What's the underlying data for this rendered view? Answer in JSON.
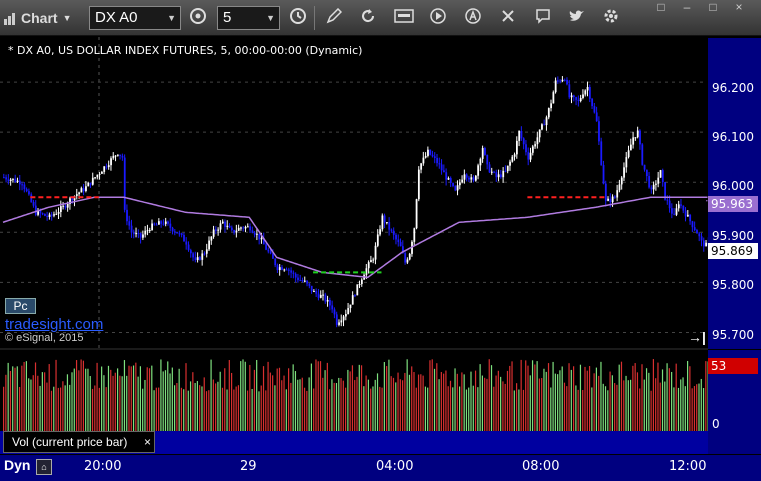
{
  "toolbar": {
    "chart_label": "Chart",
    "symbol": "DX A0",
    "interval": "5",
    "buttons": [
      "link-icon",
      "interval-icon",
      "draw-icon",
      "refresh-icon",
      "get-icon",
      "play-icon",
      "alert-icon",
      "tools-icon",
      "comment-icon",
      "twitter-icon",
      "settings-icon"
    ]
  },
  "window_controls": [
    "□",
    "–",
    "□",
    "×"
  ],
  "chart": {
    "title": "* DX A0, US DOLLAR INDEX FUTURES, 5, 00:00-00:00 (Dynamic)",
    "y_ticks": [
      "96.200",
      "96.100",
      "96.000",
      "95.900",
      "95.800",
      "95.700"
    ],
    "price_labels": {
      "vwap": "95.963",
      "last": "95.869"
    },
    "pc_label": "Pc",
    "brand": "tradesight.com",
    "copyright": "© eSignal, 2015",
    "colors": {
      "up_bar": "#ffffff",
      "down_bar": "#1a1aff",
      "vwap": "#b07be0",
      "support": "#ff2020",
      "resistance": "#20d020",
      "count": "#00a000"
    }
  },
  "volume": {
    "label": "Vol (current price bar)",
    "close_label": "×",
    "y_ticks": [
      "53",
      "0"
    ]
  },
  "x_axis": {
    "mode_label": "Dyn",
    "ticks": [
      "20:00",
      "29",
      "04:00",
      "08:00",
      "12:00"
    ]
  },
  "chart_data": {
    "type": "candlestick",
    "title": "* DX A0, US DOLLAR INDEX FUTURES, 5, 00:00-00:00 (Dynamic)",
    "x_ticks": [
      "20:00",
      "29",
      "04:00",
      "08:00",
      "12:00"
    ],
    "y_ticks": [
      96.2,
      96.1,
      96.0,
      95.9,
      95.8,
      95.7
    ],
    "ylim": [
      95.665,
      96.29
    ],
    "last_price": 95.869,
    "vwap_last": 95.963,
    "close_path": [
      [
        0,
        96.01
      ],
      [
        8,
        96.0
      ],
      [
        14,
        95.94
      ],
      [
        20,
        95.93
      ],
      [
        26,
        95.95
      ],
      [
        30,
        95.97
      ],
      [
        36,
        95.99
      ],
      [
        42,
        96.02
      ],
      [
        46,
        96.04
      ],
      [
        50,
        96.06
      ],
      [
        52,
        96.05
      ],
      [
        53,
        95.94
      ],
      [
        56,
        95.9
      ],
      [
        60,
        95.89
      ],
      [
        64,
        95.91
      ],
      [
        70,
        95.92
      ],
      [
        76,
        95.9
      ],
      [
        80,
        95.88
      ],
      [
        84,
        95.84
      ],
      [
        88,
        95.86
      ],
      [
        92,
        95.9
      ],
      [
        96,
        95.92
      ],
      [
        100,
        95.9
      ],
      [
        104,
        95.91
      ],
      [
        108,
        95.91
      ],
      [
        112,
        95.89
      ],
      [
        116,
        95.86
      ],
      [
        120,
        95.83
      ],
      [
        124,
        95.83
      ],
      [
        128,
        95.81
      ],
      [
        132,
        95.8
      ],
      [
        136,
        95.78
      ],
      [
        140,
        95.77
      ],
      [
        144,
        95.75
      ],
      [
        146,
        95.72
      ],
      [
        150,
        95.74
      ],
      [
        154,
        95.78
      ],
      [
        158,
        95.82
      ],
      [
        162,
        95.85
      ],
      [
        166,
        95.93
      ],
      [
        170,
        95.9
      ],
      [
        174,
        95.87
      ],
      [
        176,
        95.84
      ],
      [
        178,
        95.86
      ],
      [
        180,
        95.91
      ],
      [
        182,
        96.03
      ],
      [
        186,
        96.06
      ],
      [
        190,
        96.04
      ],
      [
        194,
        96.01
      ],
      [
        198,
        95.98
      ],
      [
        202,
        96.02
      ],
      [
        206,
        96.0
      ],
      [
        210,
        96.07
      ],
      [
        212,
        96.03
      ],
      [
        216,
        96.01
      ],
      [
        220,
        96.02
      ],
      [
        224,
        96.06
      ],
      [
        226,
        96.1
      ],
      [
        230,
        96.05
      ],
      [
        234,
        96.09
      ],
      [
        238,
        96.13
      ],
      [
        240,
        96.16
      ],
      [
        242,
        96.2
      ],
      [
        246,
        96.21
      ],
      [
        248,
        96.17
      ],
      [
        252,
        96.16
      ],
      [
        254,
        96.18
      ],
      [
        256,
        96.19
      ],
      [
        260,
        96.12
      ],
      [
        264,
        95.96
      ],
      [
        268,
        95.97
      ],
      [
        272,
        96.03
      ],
      [
        276,
        96.09
      ],
      [
        278,
        96.1
      ],
      [
        280,
        96.04
      ],
      [
        284,
        95.98
      ],
      [
        288,
        96.02
      ],
      [
        290,
        95.97
      ],
      [
        294,
        95.93
      ],
      [
        296,
        95.96
      ],
      [
        300,
        95.93
      ],
      [
        304,
        95.9
      ],
      [
        306,
        95.88
      ],
      [
        309,
        95.87
      ]
    ],
    "vwap": [
      [
        0,
        95.92
      ],
      [
        20,
        95.95
      ],
      [
        40,
        95.97
      ],
      [
        53,
        95.97
      ],
      [
        80,
        95.94
      ],
      [
        108,
        95.93
      ],
      [
        120,
        95.85
      ],
      [
        140,
        95.82
      ],
      [
        160,
        95.81
      ],
      [
        175,
        95.86
      ],
      [
        200,
        95.92
      ],
      [
        230,
        95.93
      ],
      [
        260,
        95.95
      ],
      [
        284,
        95.97
      ],
      [
        309,
        95.97
      ]
    ],
    "support_line": {
      "y": 95.97,
      "x_range": [
        230,
        264
      ]
    },
    "red_marker": {
      "y": 95.97,
      "x_range": [
        12,
        42
      ]
    },
    "resistance_line": {
      "y": 95.82,
      "x_range": [
        136,
        166
      ]
    },
    "volume": {
      "ylim": [
        0,
        53
      ],
      "last_value": 53
    }
  }
}
